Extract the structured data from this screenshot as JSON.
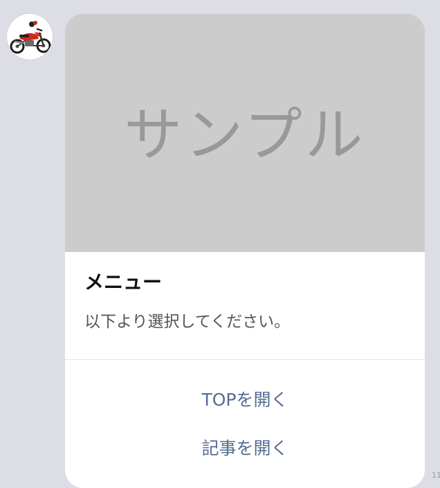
{
  "sender": {
    "avatar_icon": "motorcycle-icon"
  },
  "card": {
    "hero_text": "サンプル",
    "title": "メニュー",
    "description": "以下より選択してください。",
    "actions": [
      {
        "label": "TOPを開く"
      },
      {
        "label": "記事を開く"
      }
    ]
  },
  "message": {
    "timestamp": "11"
  },
  "colors": {
    "background": "#dcdde5",
    "hero_background": "#cccccc",
    "hero_text": "#999999",
    "action_text": "#546c93",
    "title_text": "#111111",
    "description_text": "#555555"
  }
}
